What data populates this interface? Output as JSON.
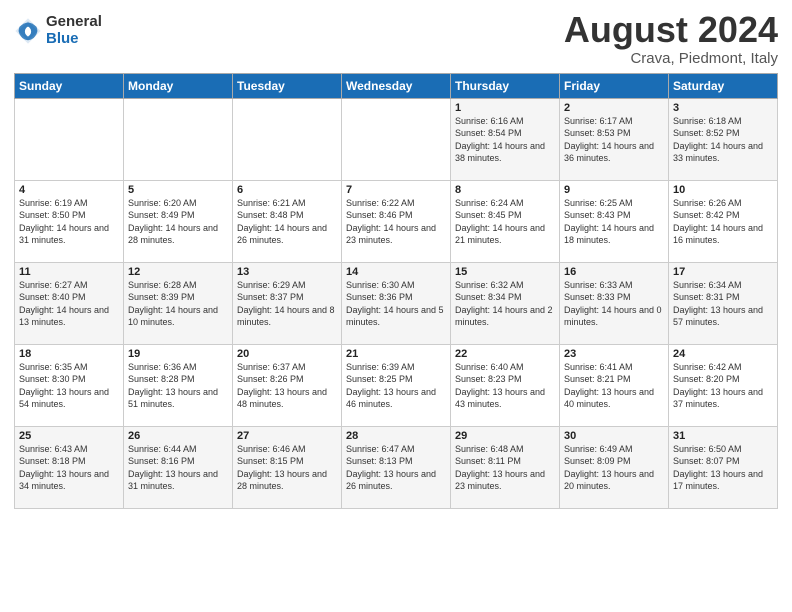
{
  "header": {
    "logo_general": "General",
    "logo_blue": "Blue",
    "title": "August 2024",
    "location": "Crava, Piedmont, Italy"
  },
  "weekdays": [
    "Sunday",
    "Monday",
    "Tuesday",
    "Wednesday",
    "Thursday",
    "Friday",
    "Saturday"
  ],
  "weeks": [
    [
      {
        "day": "",
        "sunrise": "",
        "sunset": "",
        "daylight": ""
      },
      {
        "day": "",
        "sunrise": "",
        "sunset": "",
        "daylight": ""
      },
      {
        "day": "",
        "sunrise": "",
        "sunset": "",
        "daylight": ""
      },
      {
        "day": "",
        "sunrise": "",
        "sunset": "",
        "daylight": ""
      },
      {
        "day": "1",
        "sunrise": "Sunrise: 6:16 AM",
        "sunset": "Sunset: 8:54 PM",
        "daylight": "Daylight: 14 hours and 38 minutes."
      },
      {
        "day": "2",
        "sunrise": "Sunrise: 6:17 AM",
        "sunset": "Sunset: 8:53 PM",
        "daylight": "Daylight: 14 hours and 36 minutes."
      },
      {
        "day": "3",
        "sunrise": "Sunrise: 6:18 AM",
        "sunset": "Sunset: 8:52 PM",
        "daylight": "Daylight: 14 hours and 33 minutes."
      }
    ],
    [
      {
        "day": "4",
        "sunrise": "Sunrise: 6:19 AM",
        "sunset": "Sunset: 8:50 PM",
        "daylight": "Daylight: 14 hours and 31 minutes."
      },
      {
        "day": "5",
        "sunrise": "Sunrise: 6:20 AM",
        "sunset": "Sunset: 8:49 PM",
        "daylight": "Daylight: 14 hours and 28 minutes."
      },
      {
        "day": "6",
        "sunrise": "Sunrise: 6:21 AM",
        "sunset": "Sunset: 8:48 PM",
        "daylight": "Daylight: 14 hours and 26 minutes."
      },
      {
        "day": "7",
        "sunrise": "Sunrise: 6:22 AM",
        "sunset": "Sunset: 8:46 PM",
        "daylight": "Daylight: 14 hours and 23 minutes."
      },
      {
        "day": "8",
        "sunrise": "Sunrise: 6:24 AM",
        "sunset": "Sunset: 8:45 PM",
        "daylight": "Daylight: 14 hours and 21 minutes."
      },
      {
        "day": "9",
        "sunrise": "Sunrise: 6:25 AM",
        "sunset": "Sunset: 8:43 PM",
        "daylight": "Daylight: 14 hours and 18 minutes."
      },
      {
        "day": "10",
        "sunrise": "Sunrise: 6:26 AM",
        "sunset": "Sunset: 8:42 PM",
        "daylight": "Daylight: 14 hours and 16 minutes."
      }
    ],
    [
      {
        "day": "11",
        "sunrise": "Sunrise: 6:27 AM",
        "sunset": "Sunset: 8:40 PM",
        "daylight": "Daylight: 14 hours and 13 minutes."
      },
      {
        "day": "12",
        "sunrise": "Sunrise: 6:28 AM",
        "sunset": "Sunset: 8:39 PM",
        "daylight": "Daylight: 14 hours and 10 minutes."
      },
      {
        "day": "13",
        "sunrise": "Sunrise: 6:29 AM",
        "sunset": "Sunset: 8:37 PM",
        "daylight": "Daylight: 14 hours and 8 minutes."
      },
      {
        "day": "14",
        "sunrise": "Sunrise: 6:30 AM",
        "sunset": "Sunset: 8:36 PM",
        "daylight": "Daylight: 14 hours and 5 minutes."
      },
      {
        "day": "15",
        "sunrise": "Sunrise: 6:32 AM",
        "sunset": "Sunset: 8:34 PM",
        "daylight": "Daylight: 14 hours and 2 minutes."
      },
      {
        "day": "16",
        "sunrise": "Sunrise: 6:33 AM",
        "sunset": "Sunset: 8:33 PM",
        "daylight": "Daylight: 14 hours and 0 minutes."
      },
      {
        "day": "17",
        "sunrise": "Sunrise: 6:34 AM",
        "sunset": "Sunset: 8:31 PM",
        "daylight": "Daylight: 13 hours and 57 minutes."
      }
    ],
    [
      {
        "day": "18",
        "sunrise": "Sunrise: 6:35 AM",
        "sunset": "Sunset: 8:30 PM",
        "daylight": "Daylight: 13 hours and 54 minutes."
      },
      {
        "day": "19",
        "sunrise": "Sunrise: 6:36 AM",
        "sunset": "Sunset: 8:28 PM",
        "daylight": "Daylight: 13 hours and 51 minutes."
      },
      {
        "day": "20",
        "sunrise": "Sunrise: 6:37 AM",
        "sunset": "Sunset: 8:26 PM",
        "daylight": "Daylight: 13 hours and 48 minutes."
      },
      {
        "day": "21",
        "sunrise": "Sunrise: 6:39 AM",
        "sunset": "Sunset: 8:25 PM",
        "daylight": "Daylight: 13 hours and 46 minutes."
      },
      {
        "day": "22",
        "sunrise": "Sunrise: 6:40 AM",
        "sunset": "Sunset: 8:23 PM",
        "daylight": "Daylight: 13 hours and 43 minutes."
      },
      {
        "day": "23",
        "sunrise": "Sunrise: 6:41 AM",
        "sunset": "Sunset: 8:21 PM",
        "daylight": "Daylight: 13 hours and 40 minutes."
      },
      {
        "day": "24",
        "sunrise": "Sunrise: 6:42 AM",
        "sunset": "Sunset: 8:20 PM",
        "daylight": "Daylight: 13 hours and 37 minutes."
      }
    ],
    [
      {
        "day": "25",
        "sunrise": "Sunrise: 6:43 AM",
        "sunset": "Sunset: 8:18 PM",
        "daylight": "Daylight: 13 hours and 34 minutes."
      },
      {
        "day": "26",
        "sunrise": "Sunrise: 6:44 AM",
        "sunset": "Sunset: 8:16 PM",
        "daylight": "Daylight: 13 hours and 31 minutes."
      },
      {
        "day": "27",
        "sunrise": "Sunrise: 6:46 AM",
        "sunset": "Sunset: 8:15 PM",
        "daylight": "Daylight: 13 hours and 28 minutes."
      },
      {
        "day": "28",
        "sunrise": "Sunrise: 6:47 AM",
        "sunset": "Sunset: 8:13 PM",
        "daylight": "Daylight: 13 hours and 26 minutes."
      },
      {
        "day": "29",
        "sunrise": "Sunrise: 6:48 AM",
        "sunset": "Sunset: 8:11 PM",
        "daylight": "Daylight: 13 hours and 23 minutes."
      },
      {
        "day": "30",
        "sunrise": "Sunrise: 6:49 AM",
        "sunset": "Sunset: 8:09 PM",
        "daylight": "Daylight: 13 hours and 20 minutes."
      },
      {
        "day": "31",
        "sunrise": "Sunrise: 6:50 AM",
        "sunset": "Sunset: 8:07 PM",
        "daylight": "Daylight: 13 hours and 17 minutes."
      }
    ]
  ]
}
